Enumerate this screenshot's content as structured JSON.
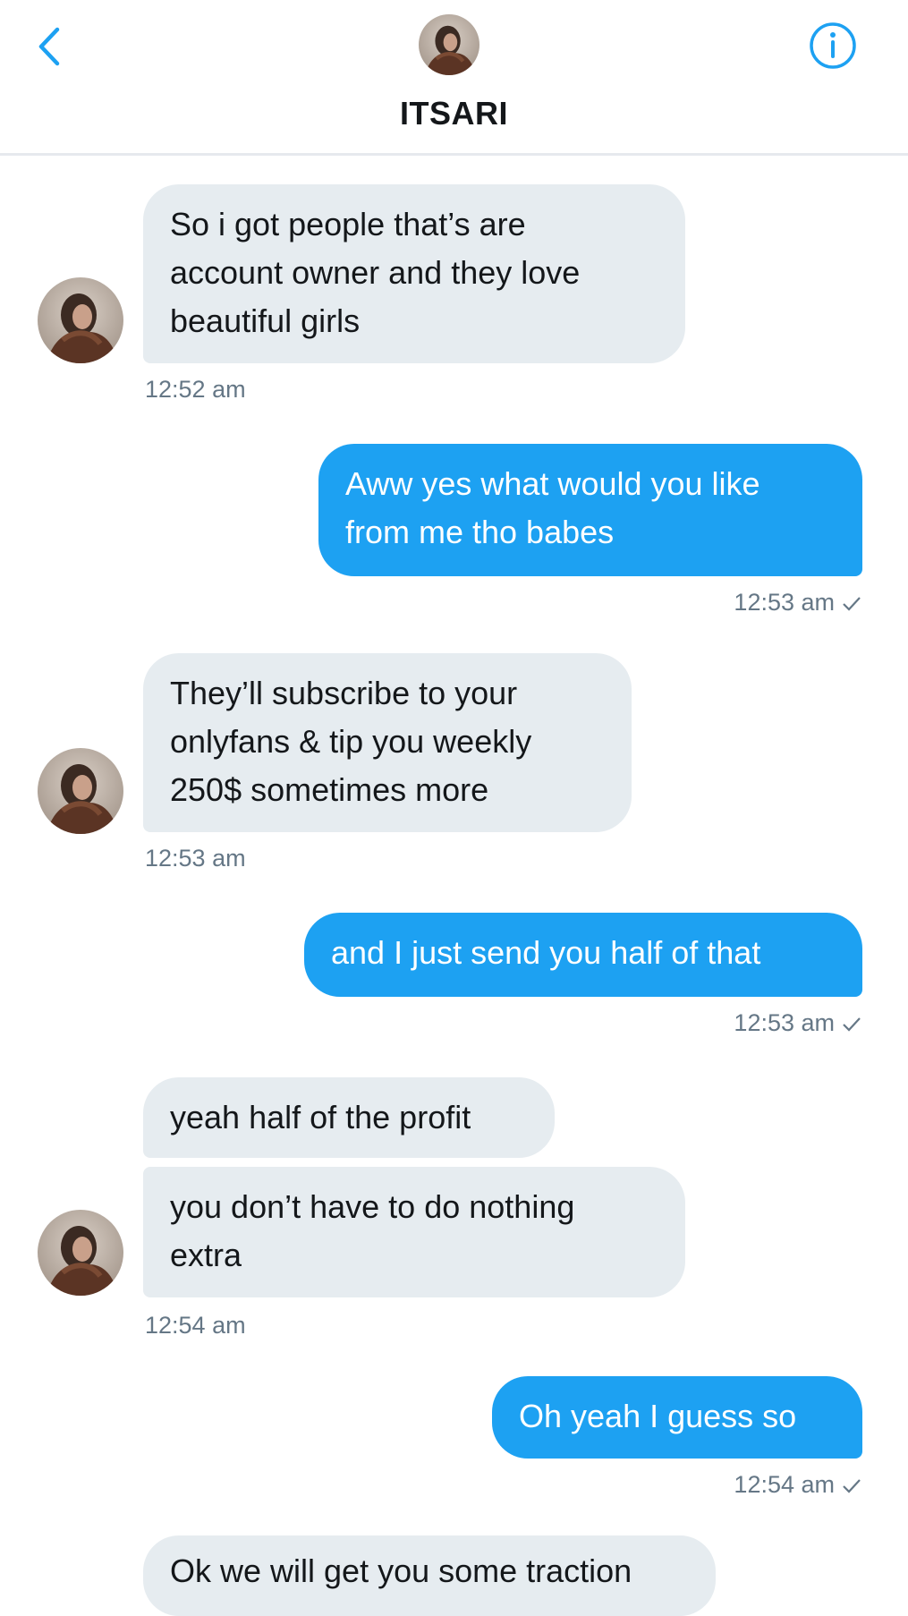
{
  "header": {
    "title": "ITSARI",
    "back_icon": "chevron-left-icon",
    "info_icon": "info-icon",
    "accent_color": "#1da1f2"
  },
  "messages": [
    {
      "direction": "in",
      "text": "So i got people that’s are\naccount owner and they love\nbeautiful girls",
      "time": "12:52 am"
    },
    {
      "direction": "out",
      "text": "Aww yes what would you like\nfrom me tho babes",
      "time": "12:53 am"
    },
    {
      "direction": "in",
      "text": "They’ll subscribe to your\nonlyfans & tip you weekly\n250$ sometimes more",
      "time": "12:53 am"
    },
    {
      "direction": "out",
      "text": "and I just send you half of that",
      "time": "12:53 am"
    },
    {
      "direction": "in",
      "text": "yeah half of the profit",
      "time": ""
    },
    {
      "direction": "in",
      "text": "you don’t have to do nothing\nextra",
      "time": "12:54 am"
    },
    {
      "direction": "out",
      "text": "Oh yeah I guess so",
      "time": "12:54 am"
    }
  ],
  "partial_message": {
    "direction": "in",
    "text": "Ok we will get you some traction"
  }
}
